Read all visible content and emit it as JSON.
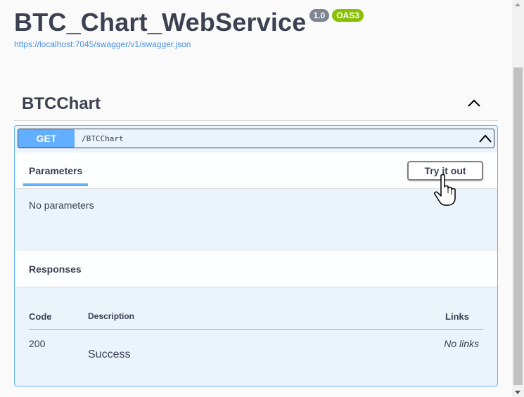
{
  "header": {
    "title": "BTC_Chart_WebService",
    "version_badge": "1.0",
    "oas_badge": "OAS3",
    "spec_url": "https://localhost:7045/swagger/v1/swagger.json"
  },
  "tag": {
    "name": "BTCChart",
    "toggle_icon": "chevron-up-icon"
  },
  "operation": {
    "method": "GET",
    "path": "/BTCChart",
    "toggle_icon": "chevron-up-icon",
    "parameters": {
      "tab_label": "Parameters",
      "try_button_label": "Try it out",
      "empty_text": "No parameters"
    },
    "responses": {
      "header_label": "Responses",
      "columns": {
        "code": "Code",
        "description": "Description",
        "links": "Links"
      },
      "rows": [
        {
          "code": "200",
          "description": "Success",
          "links": "No links"
        }
      ]
    }
  },
  "colors": {
    "get_method": "#61affe",
    "opblock_bg": "#ebf3fb",
    "text": "#3b4151",
    "link": "#4990e2",
    "oas_badge": "#89bf04",
    "version_badge": "#7d8492"
  }
}
